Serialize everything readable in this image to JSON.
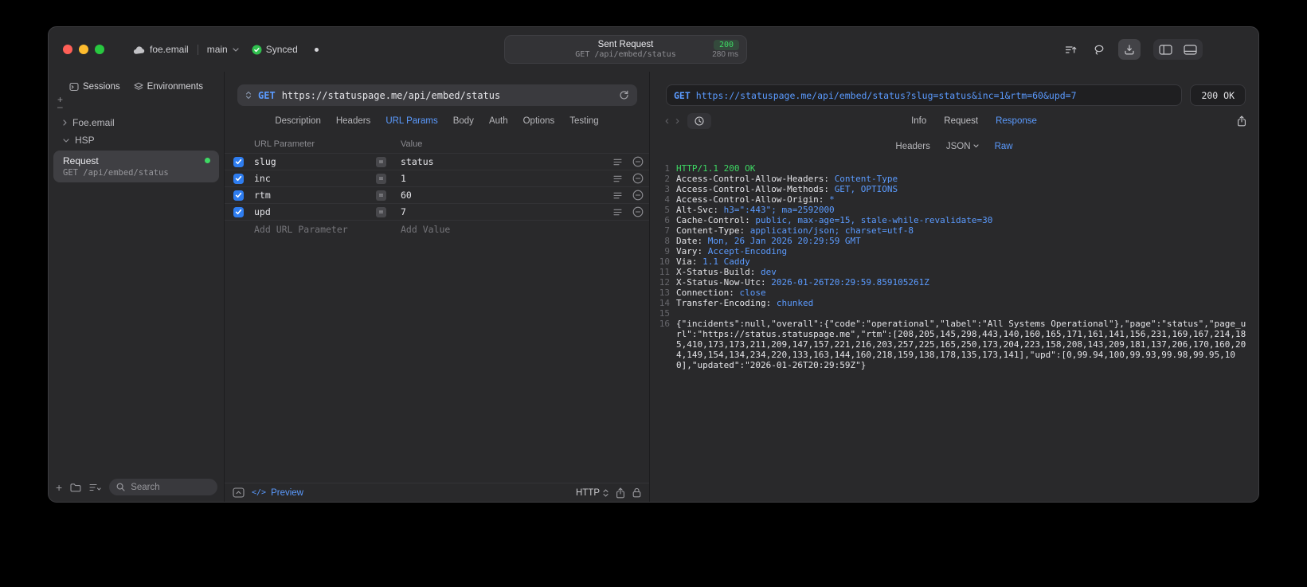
{
  "colors": {
    "accent_blue": "#5b9bff",
    "success_green": "#3ed964",
    "checkbox_blue": "#2e7df0"
  },
  "titlebar": {
    "project_name": "foe.email",
    "branch": "main",
    "sync_label": "Synced",
    "center": {
      "title": "Sent Request",
      "status_code": "200",
      "subtitle": "GET /api/embed/status",
      "duration": "280 ms"
    }
  },
  "sidebar": {
    "tabs": [
      {
        "label": "Sessions"
      },
      {
        "label": "Environments"
      }
    ],
    "tree": [
      {
        "label": "Foe.email"
      },
      {
        "label": "HSP"
      }
    ],
    "request_item": {
      "title": "Request",
      "subtitle": "GET /api/embed/status"
    },
    "search_placeholder": "Search"
  },
  "request_panel": {
    "method": "GET",
    "url": "https://statuspage.me/api/embed/status",
    "tabs": [
      "Description",
      "Headers",
      "URL Params",
      "Body",
      "Auth",
      "Options",
      "Testing"
    ],
    "active_tab": "URL Params",
    "params": {
      "col_name": "URL Parameter",
      "col_value": "Value",
      "rows": [
        {
          "name": "slug",
          "value": "status",
          "enabled": true
        },
        {
          "name": "inc",
          "value": "1",
          "enabled": true
        },
        {
          "name": "rtm",
          "value": "60",
          "enabled": true
        },
        {
          "name": "upd",
          "value": "7",
          "enabled": true
        }
      ],
      "add_name_placeholder": "Add URL Parameter",
      "add_value_placeholder": "Add Value"
    },
    "footer": {
      "preview_label": "Preview",
      "code_glyph": "</>",
      "protocol_label": "HTTP"
    }
  },
  "response_panel": {
    "method": "GET",
    "request_url": "https://statuspage.me/api/embed/status?slug=status&inc=1&rtm=60&upd=7",
    "status": "200 OK",
    "tabs": [
      "Info",
      "Request",
      "Response"
    ],
    "active_tab": "Response",
    "subtabs": [
      "Headers",
      "JSON",
      "Raw"
    ],
    "active_subtab": "Raw",
    "response": {
      "status_line": "HTTP/1.1 200 OK",
      "headers": [
        {
          "name": "Access-Control-Allow-Headers",
          "value": "Content-Type"
        },
        {
          "name": "Access-Control-Allow-Methods",
          "value": "GET, OPTIONS"
        },
        {
          "name": "Access-Control-Allow-Origin",
          "value": "*"
        },
        {
          "name": "Alt-Svc",
          "value": "h3=\":443\"; ma=2592000"
        },
        {
          "name": "Cache-Control",
          "value": "public, max-age=15, stale-while-revalidate=30"
        },
        {
          "name": "Content-Type",
          "value": "application/json; charset=utf-8"
        },
        {
          "name": "Date",
          "value": "Mon, 26 Jan 2026 20:29:59 GMT"
        },
        {
          "name": "Vary",
          "value": "Accept-Encoding"
        },
        {
          "name": "Via",
          "value": "1.1 Caddy"
        },
        {
          "name": "X-Status-Build",
          "value": "dev"
        },
        {
          "name": "X-Status-Now-Utc",
          "value": "2026-01-26T20:29:59.859105261Z"
        },
        {
          "name": "Connection",
          "value": "close"
        },
        {
          "name": "Transfer-Encoding",
          "value": "chunked"
        }
      ],
      "body": "{\"incidents\":null,\"overall\":{\"code\":\"operational\",\"label\":\"All Systems Operational\"},\"page\":\"status\",\"page_url\":\"https://status.statuspage.me\",\"rtm\":[208,205,145,298,443,140,160,165,171,161,141,156,231,169,167,214,185,410,173,173,211,209,147,157,221,216,203,257,225,165,250,173,204,223,158,208,143,209,181,137,206,170,160,204,149,154,134,234,220,133,163,144,160,218,159,138,178,135,173,141],\"upd\":[0,99.94,100,99.93,99.98,99.95,100],\"updated\":\"2026-01-26T20:29:59Z\"}"
    }
  }
}
